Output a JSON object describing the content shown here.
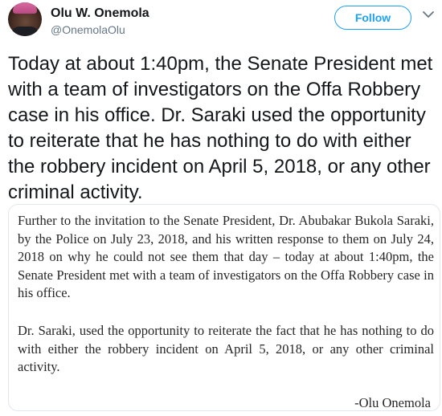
{
  "author": {
    "name": "Olu W. Onemola",
    "handle": "@OnemolaOlu",
    "avatar_icon": "profile-photo"
  },
  "actions": {
    "follow_label": "Follow",
    "more_icon": "chevron-down-icon"
  },
  "tweet": {
    "text": "Today at about 1:40pm, the Senate President met with a team of investigators on the Offa Robbery case in his office. Dr. Saraki used the opportunity to reiterate that he has nothing to do with either the robbery incident on April 5, 2018, or any other criminal activity."
  },
  "statement": {
    "paragraph1": "Further to the invitation to the Senate President, Dr. Abubakar Bukola Saraki, by the Police on July 23, 2018, and his written response to them on July 24, 2018 on why he could not see them that day – today at about 1:40pm, the Senate President met with a team of investigators on the Offa Robbery case in his office.",
    "paragraph2": "Dr. Saraki, used the opportunity to reiterate the fact that he has nothing to do with either the robbery incident on April 5, 2018, or any other criminal activity.",
    "signature": "-Olu Onemola"
  },
  "colors": {
    "accent": "#1da1f2",
    "text": "#14171a",
    "muted": "#657786",
    "border": "#e1e8ed"
  }
}
